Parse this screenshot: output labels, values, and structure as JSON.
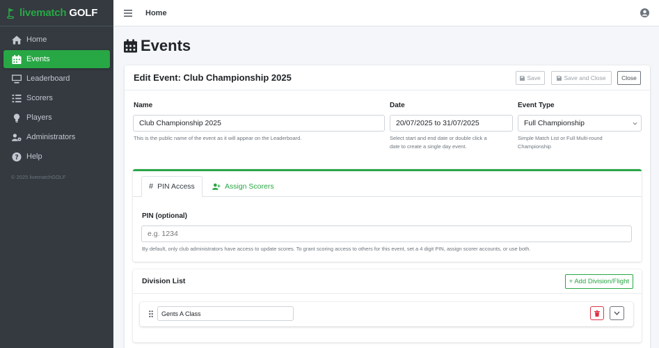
{
  "brand": {
    "prefix": "livematch",
    "suffix": " GOLF",
    "accent": "#28a745"
  },
  "sidebar": {
    "items": [
      {
        "label": "Home",
        "icon": "home-icon",
        "active": false
      },
      {
        "label": "Events",
        "icon": "calendar-icon",
        "active": true
      },
      {
        "label": "Leaderboard",
        "icon": "monitor-icon",
        "active": false
      },
      {
        "label": "Scorers",
        "icon": "list-icon",
        "active": false
      },
      {
        "label": "Players",
        "icon": "lightbulb-icon",
        "active": false
      },
      {
        "label": "Administrators",
        "icon": "users-gear-icon",
        "active": false
      },
      {
        "label": "Help",
        "icon": "question-circle-icon",
        "active": false
      }
    ],
    "copyright": "© 2025 livematchGOLF"
  },
  "topbar": {
    "home_label": "Home"
  },
  "page": {
    "title": "Events"
  },
  "card": {
    "title": "Edit Event: Club Championship 2025",
    "buttons": {
      "save": "Save",
      "save_close": "Save and Close",
      "close": "Close"
    }
  },
  "form": {
    "name": {
      "label": "Name",
      "value": "Club Championship 2025",
      "help": "This is the public name of the event as it will appear on the Leaderboard."
    },
    "date": {
      "label": "Date",
      "value": "20/07/2025 to 31/07/2025",
      "help1": "Select start and end date or double click a",
      "help2": "date to create a single day event."
    },
    "event_type": {
      "label": "Event Type",
      "value": "Full Championship",
      "help1": "Simple Match List or Full Multi-round",
      "help2": "Championship"
    }
  },
  "tabs": {
    "pin_access": {
      "label": "PIN Access",
      "symbol": "#"
    },
    "assign_scorers": {
      "label": "Assign Scorers"
    }
  },
  "pin": {
    "label": "PIN (optional)",
    "placeholder": "e.g. 1234",
    "help": "By default, only club administrators have access to update scores. To grant scoring access to others for this event, set a 4 digit PIN, assign scorer accounts, or use both."
  },
  "division": {
    "title": "Division List",
    "add_label": "+ Add Division/Flight",
    "rows": [
      {
        "name": "Gents A Class"
      }
    ]
  }
}
